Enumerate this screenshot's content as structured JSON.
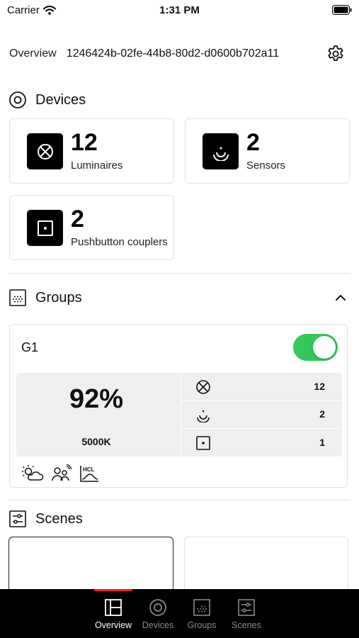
{
  "status_bar": {
    "carrier": "Carrier",
    "time": "1:31 PM"
  },
  "header": {
    "label": "Overview",
    "id": "1246424b-02fe-44b8-80d2-d0600b702a11",
    "settings_icon": "gear-icon"
  },
  "devices": {
    "title": "Devices",
    "cards": [
      {
        "count": "12",
        "label": "Luminaires",
        "icon": "luminaire-icon"
      },
      {
        "count": "2",
        "label": "Sensors",
        "icon": "sensor-icon"
      },
      {
        "count": "2",
        "label": "Pushbutton couplers",
        "icon": "pushbutton-icon"
      }
    ]
  },
  "groups": {
    "title": "Groups",
    "items": [
      {
        "name": "G1",
        "enabled": true,
        "level": "92%",
        "color_temp": "5000K",
        "counts": {
          "luminaires": "12",
          "sensors": "2",
          "pushbuttons": "1"
        },
        "features": [
          "daylight-icon",
          "occupancy-icon",
          "hcl-icon"
        ]
      }
    ]
  },
  "scenes": {
    "title": "Scenes"
  },
  "tabbar": {
    "tabs": [
      {
        "label": "Overview",
        "active": true
      },
      {
        "label": "Devices",
        "active": false
      },
      {
        "label": "Groups",
        "active": false
      },
      {
        "label": "Scenes",
        "active": false
      }
    ]
  },
  "colors": {
    "accent": "#e8202a",
    "toggle_on": "#34c759",
    "panel_bg": "#efefef"
  }
}
